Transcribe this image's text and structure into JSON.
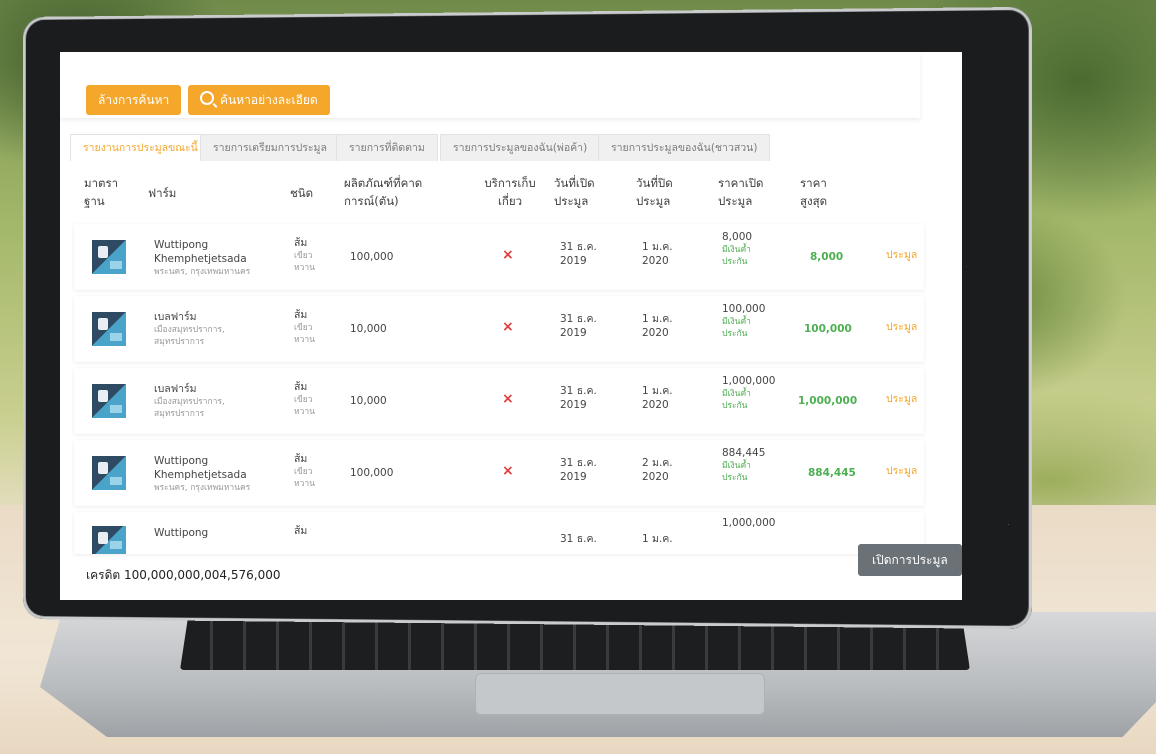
{
  "toolbar": {
    "clear_label": "ล้างการค้นหา",
    "advanced_label": "ค้นหาอย่างละเอียด"
  },
  "tabs": [
    {
      "label": "รายงานการประมูลขณะนี้",
      "active": true
    },
    {
      "label": "รายการเตรียมการประมูล"
    },
    {
      "label": "รายการที่ติดตาม"
    },
    {
      "label": "รายการประมูลของฉัน(พ่อค้า)"
    },
    {
      "label": "รายการประมูลของฉัน(ชาวสวน)"
    }
  ],
  "headers": {
    "standard": [
      "มาตรา",
      "ฐาน"
    ],
    "farm": "ฟาร์ม",
    "type": "ชนิด",
    "yield": [
      "ผลิตภัณฑ์ที่คาด",
      "การณ์(ตัน)"
    ],
    "harvest": [
      "บริการเก็บ",
      "เกี่ยว"
    ],
    "open_date": [
      "วันที่เปิด",
      "ประมูล"
    ],
    "close_date": [
      "วันที่ปิด",
      "ประมูล"
    ],
    "open_price": [
      "ราคาเปิด",
      "ประมูล"
    ],
    "max_price": [
      "ราคา",
      "สูงสุด"
    ]
  },
  "rows": [
    {
      "farm": "Wuttipong",
      "farm2": "Khemphetjetsada",
      "location": "พระนคร, กรุงเทพมหานคร",
      "loc2": "",
      "type": "ส้ม",
      "type_sub1": "เขียว",
      "type_sub2": "หวาน",
      "yield": "100,000",
      "harvest": "×",
      "open1": "31 ธ.ค.",
      "open2": "2019",
      "close1": "1 ม.ค.",
      "close2": "2020",
      "open_price": "8,000",
      "deposit1": "มีเงินค้ำ",
      "deposit2": "ประกัน",
      "max_price": "8,000",
      "action": "ประมูล"
    },
    {
      "farm": "เบลฟาร์ม",
      "farm2": "",
      "location": "เมืองสมุทรปราการ,",
      "loc2": "สมุทรปราการ",
      "type": "ส้ม",
      "type_sub1": "เขียว",
      "type_sub2": "หวาน",
      "yield": "10,000",
      "harvest": "×",
      "open1": "31 ธ.ค.",
      "open2": "2019",
      "close1": "1 ม.ค.",
      "close2": "2020",
      "open_price": "100,000",
      "deposit1": "มีเงินค้ำ",
      "deposit2": "ประกัน",
      "max_price": "100,000",
      "action": "ประมูล"
    },
    {
      "farm": "เบลฟาร์ม",
      "farm2": "",
      "location": "เมืองสมุทรปราการ,",
      "loc2": "สมุทรปราการ",
      "type": "ส้ม",
      "type_sub1": "เขียว",
      "type_sub2": "หวาน",
      "yield": "10,000",
      "harvest": "×",
      "open1": "31 ธ.ค.",
      "open2": "2019",
      "close1": "1 ม.ค.",
      "close2": "2020",
      "open_price": "1,000,000",
      "deposit1": "มีเงินค้ำ",
      "deposit2": "ประกัน",
      "max_price": "1,000,000",
      "action": "ประมูล"
    },
    {
      "farm": "Wuttipong",
      "farm2": "Khemphetjetsada",
      "location": "พระนคร, กรุงเทพมหานคร",
      "loc2": "",
      "type": "ส้ม",
      "type_sub1": "เขียว",
      "type_sub2": "หวาน",
      "yield": "100,000",
      "harvest": "×",
      "open1": "31 ธ.ค.",
      "open2": "2019",
      "close1": "2 ม.ค.",
      "close2": "2020",
      "open_price": "884,445",
      "deposit1": "มีเงินค้ำ",
      "deposit2": "ประกัน",
      "max_price": "884,445",
      "action": "ประมูล"
    },
    {
      "farm": "Wuttipong",
      "farm2": "",
      "location": "",
      "loc2": "",
      "type": "ส้ม",
      "type_sub1": "",
      "type_sub2": "",
      "yield": "",
      "harvest": "",
      "open1": "31 ธ.ค.",
      "open2": "",
      "close1": "1 ม.ค.",
      "close2": "",
      "open_price": "1,000,000",
      "deposit1": "",
      "deposit2": "",
      "max_price": "",
      "action": ""
    }
  ],
  "footer": {
    "credit": "เครดิต 100,000,000,004,576,000",
    "open_button": "เปิดการประมูล"
  },
  "colors": {
    "accent": "#f4a72b",
    "green": "#4caf50",
    "red": "#e03b3b",
    "button_gray": "#6a7277"
  }
}
